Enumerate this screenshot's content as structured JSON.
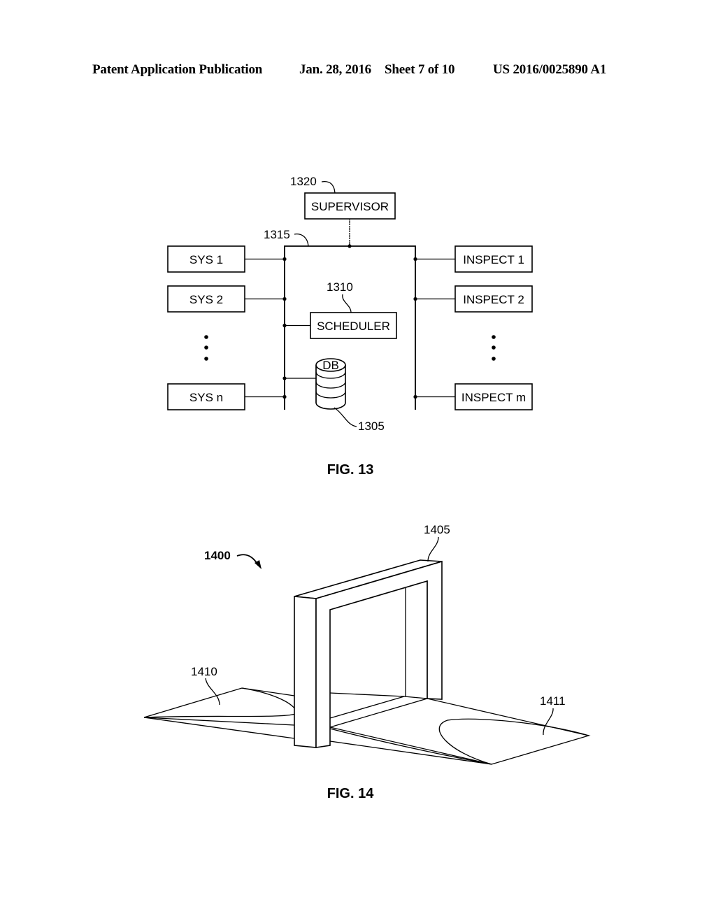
{
  "header": {
    "publication": "Patent Application Publication",
    "date": "Jan. 28, 2016",
    "sheet": "Sheet 7 of 10",
    "number": "US 2016/0025890 A1"
  },
  "fig13": {
    "caption": "FIG. 13",
    "supervisor": {
      "label": "SUPERVISOR",
      "ref": "1320"
    },
    "bus_ref": "1315",
    "scheduler": {
      "label": "SCHEDULER",
      "ref": "1310"
    },
    "database": {
      "label": "DB",
      "ref": "1305"
    },
    "systems": [
      "SYS 1",
      "SYS 2",
      "SYS n"
    ],
    "inspectors": [
      "INSPECT 1",
      "INSPECT 2",
      "INSPECT m"
    ]
  },
  "fig14": {
    "caption": "FIG. 14",
    "assembly_ref": "1400",
    "gate_ref": "1405",
    "left_zone_ref": "1410",
    "right_zone_ref": "1411"
  }
}
